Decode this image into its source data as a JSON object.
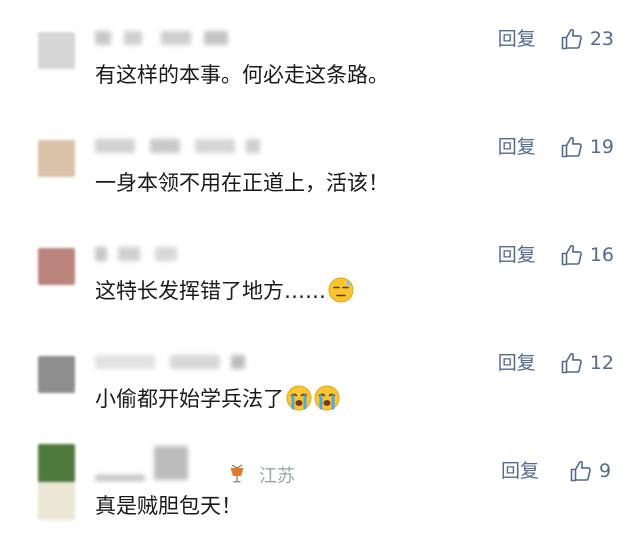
{
  "comments": [
    {
      "text": "有这样的本事。何必走这条路。",
      "reply": "回复",
      "likes": "23",
      "avatar_color": "#d6d6d6"
    },
    {
      "text": "一身本领不用在正道上，活该！",
      "reply": "回复",
      "likes": "19",
      "avatar_color": "#d9c2a8"
    },
    {
      "text": "这特长发挥错了地方……",
      "reply": "回复",
      "likes": "16",
      "avatar_color": "#b9847b",
      "emoji": "downcast-sweat-face"
    },
    {
      "text": "小偷都开始学兵法了",
      "reply": "回复",
      "likes": "12",
      "avatar_color": "#8d8d8d",
      "emoji": "loudly-crying-face"
    },
    {
      "text": "真是贼胆包天！",
      "reply": "回复",
      "likes": "9",
      "avatar_color": "#4f7a3e",
      "region": "江苏"
    }
  ],
  "colors": {
    "accent": "#536b8f",
    "text": "#1a1a1a",
    "region": "#9aa3ad"
  }
}
